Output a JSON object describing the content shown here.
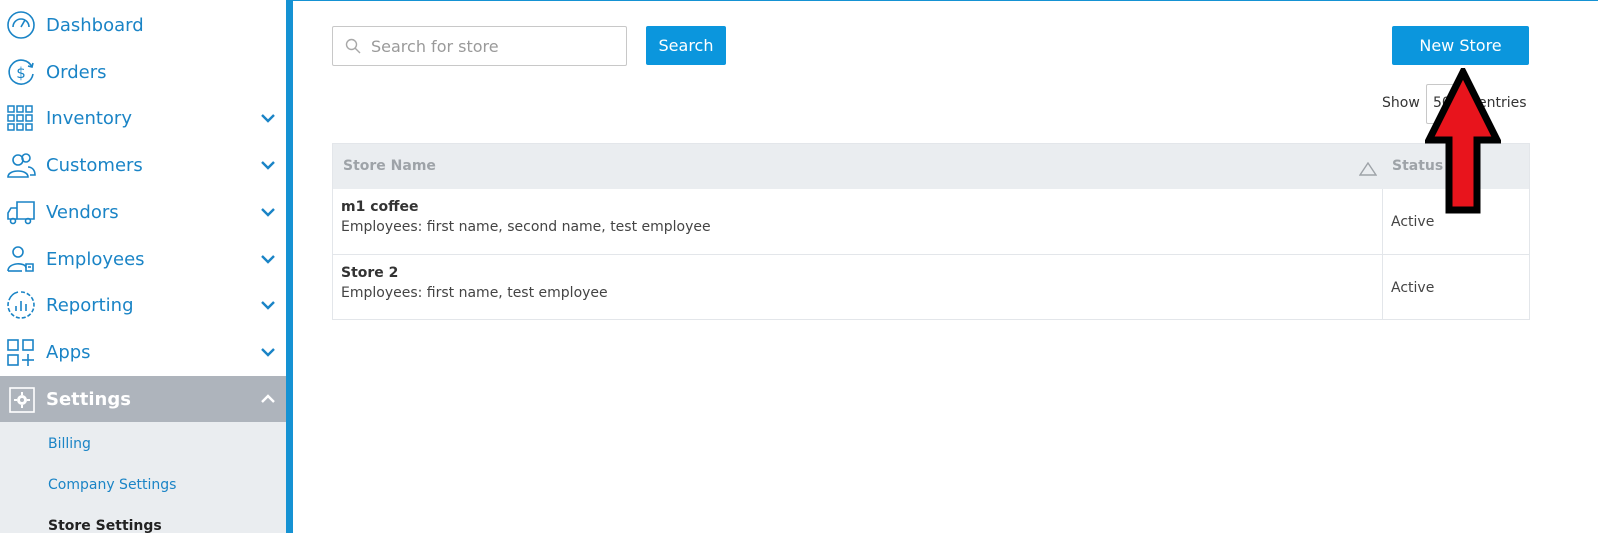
{
  "sidebar": {
    "items": [
      {
        "label": "Dashboard",
        "icon": "speedometer-icon",
        "has_chevron": false
      },
      {
        "label": "Orders",
        "icon": "dollar-refresh-icon",
        "has_chevron": false
      },
      {
        "label": "Inventory",
        "icon": "grid-icon",
        "has_chevron": true
      },
      {
        "label": "Customers",
        "icon": "users-icon",
        "has_chevron": true
      },
      {
        "label": "Vendors",
        "icon": "truck-icon",
        "has_chevron": true
      },
      {
        "label": "Employees",
        "icon": "employee-icon",
        "has_chevron": true
      },
      {
        "label": "Reporting",
        "icon": "chart-circle-icon",
        "has_chevron": true
      },
      {
        "label": "Apps",
        "icon": "apps-plus-icon",
        "has_chevron": true
      },
      {
        "label": "Settings",
        "icon": "gear-icon",
        "has_chevron": true,
        "active": true
      }
    ],
    "settings_submenu": [
      {
        "label": "Billing"
      },
      {
        "label": "Company Settings"
      },
      {
        "label": "Store Settings"
      }
    ]
  },
  "toolbar": {
    "search_placeholder": "Search for store",
    "search_value": "",
    "search_button": "Search",
    "new_store_button": "New Store"
  },
  "pagination": {
    "show_label": "Show",
    "entries_value": "50",
    "entries_label": "entries"
  },
  "table": {
    "columns": [
      "Store Name",
      "Status"
    ],
    "rows": [
      {
        "name": "m1 coffee",
        "employees": "Employees: first name, second name, test employee",
        "status": "Active"
      },
      {
        "name": "Store 2",
        "employees": "Employees: first name, test employee",
        "status": "Active"
      }
    ]
  },
  "colors": {
    "accent": "#1592d3",
    "button": "#0b96dd",
    "nav_text": "#1a84c6",
    "active_nav_bg": "#aeb4bc",
    "arrow_fill": "#e8141c"
  }
}
